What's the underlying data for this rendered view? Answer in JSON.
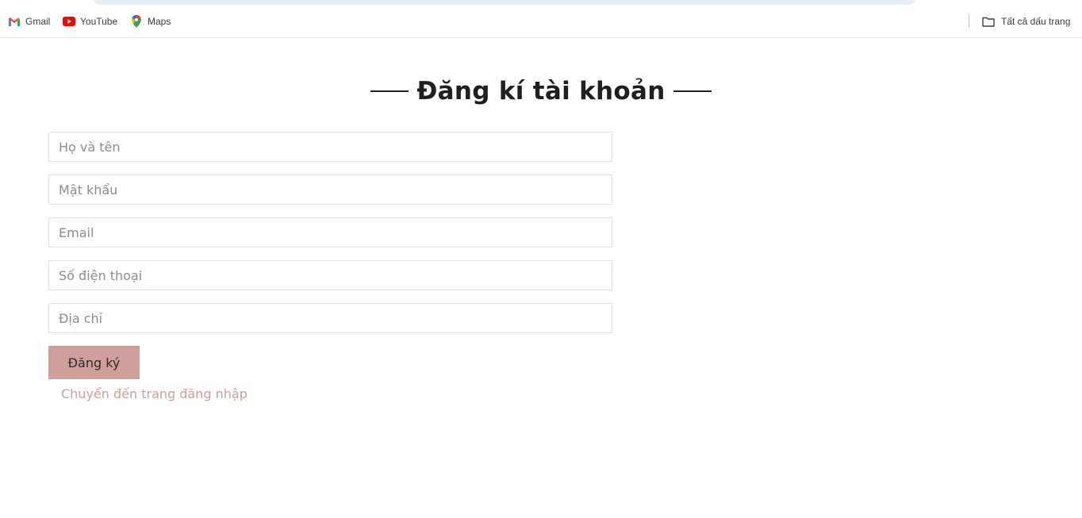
{
  "bookmarks": {
    "items": [
      {
        "label": "Gmail",
        "icon": "gmail-icon"
      },
      {
        "label": "YouTube",
        "icon": "youtube-icon"
      },
      {
        "label": "Maps",
        "icon": "maps-pin-icon"
      }
    ],
    "all_bookmarks": {
      "label": "Tất cả dấu trang",
      "icon": "folder-icon"
    }
  },
  "page": {
    "title": "Đăng kí tài khoản",
    "fields": [
      {
        "name": "fullname",
        "placeholder": "Họ và tên",
        "value": ""
      },
      {
        "name": "password",
        "placeholder": "Mật khẩu",
        "value": ""
      },
      {
        "name": "email",
        "placeholder": "Email",
        "value": ""
      },
      {
        "name": "phone",
        "placeholder": "Số điện thoại",
        "value": ""
      },
      {
        "name": "address",
        "placeholder": "Địa chỉ",
        "value": ""
      }
    ],
    "submit_label": "Đăng ký",
    "login_link": "Chuyển đến trang đăng nhập"
  },
  "colors": {
    "accent": "#d19f9b",
    "title": "#1f1f1f",
    "input_border": "#e3e3e3",
    "bookmark_text": "#3c4043"
  }
}
